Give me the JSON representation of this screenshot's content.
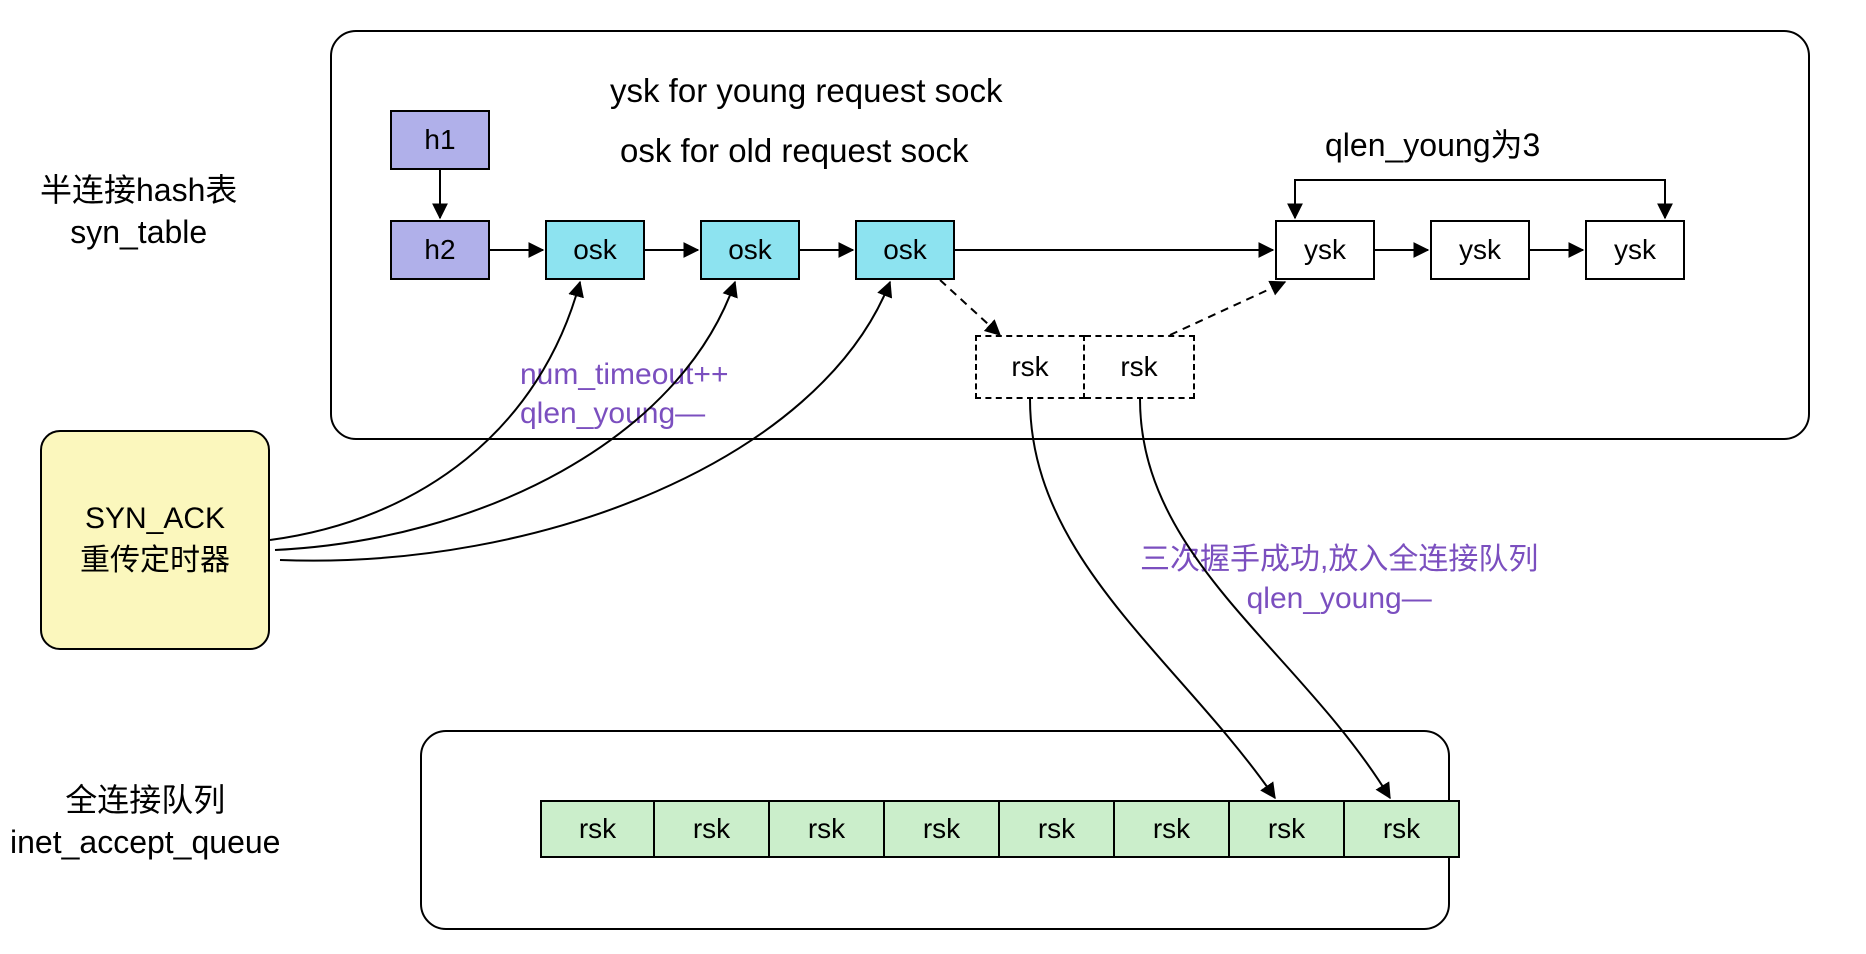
{
  "left_labels": {
    "syn_table": "半连接hash表\nsyn_table",
    "accept_queue": "全连接队列\ninet_accept_queue"
  },
  "top_text": {
    "ysk": "ysk for young request sock",
    "osk": "osk for old request sock",
    "qlen_young": "qlen_young为3"
  },
  "hash": {
    "h1": "h1",
    "h2": "h2"
  },
  "osk": {
    "label": "osk"
  },
  "ysk": {
    "label": "ysk"
  },
  "rsk": {
    "label": "rsk"
  },
  "timeout_text": "num_timeout++\nqlen_young—",
  "syn_ack_box": "SYN_ACK\n重传定时器",
  "handshake_text": "三次握手成功,放入全连接队列\nqlen_young—",
  "accept_row": [
    "rsk",
    "rsk",
    "rsk",
    "rsk",
    "rsk",
    "rsk",
    "rsk",
    "rsk"
  ]
}
